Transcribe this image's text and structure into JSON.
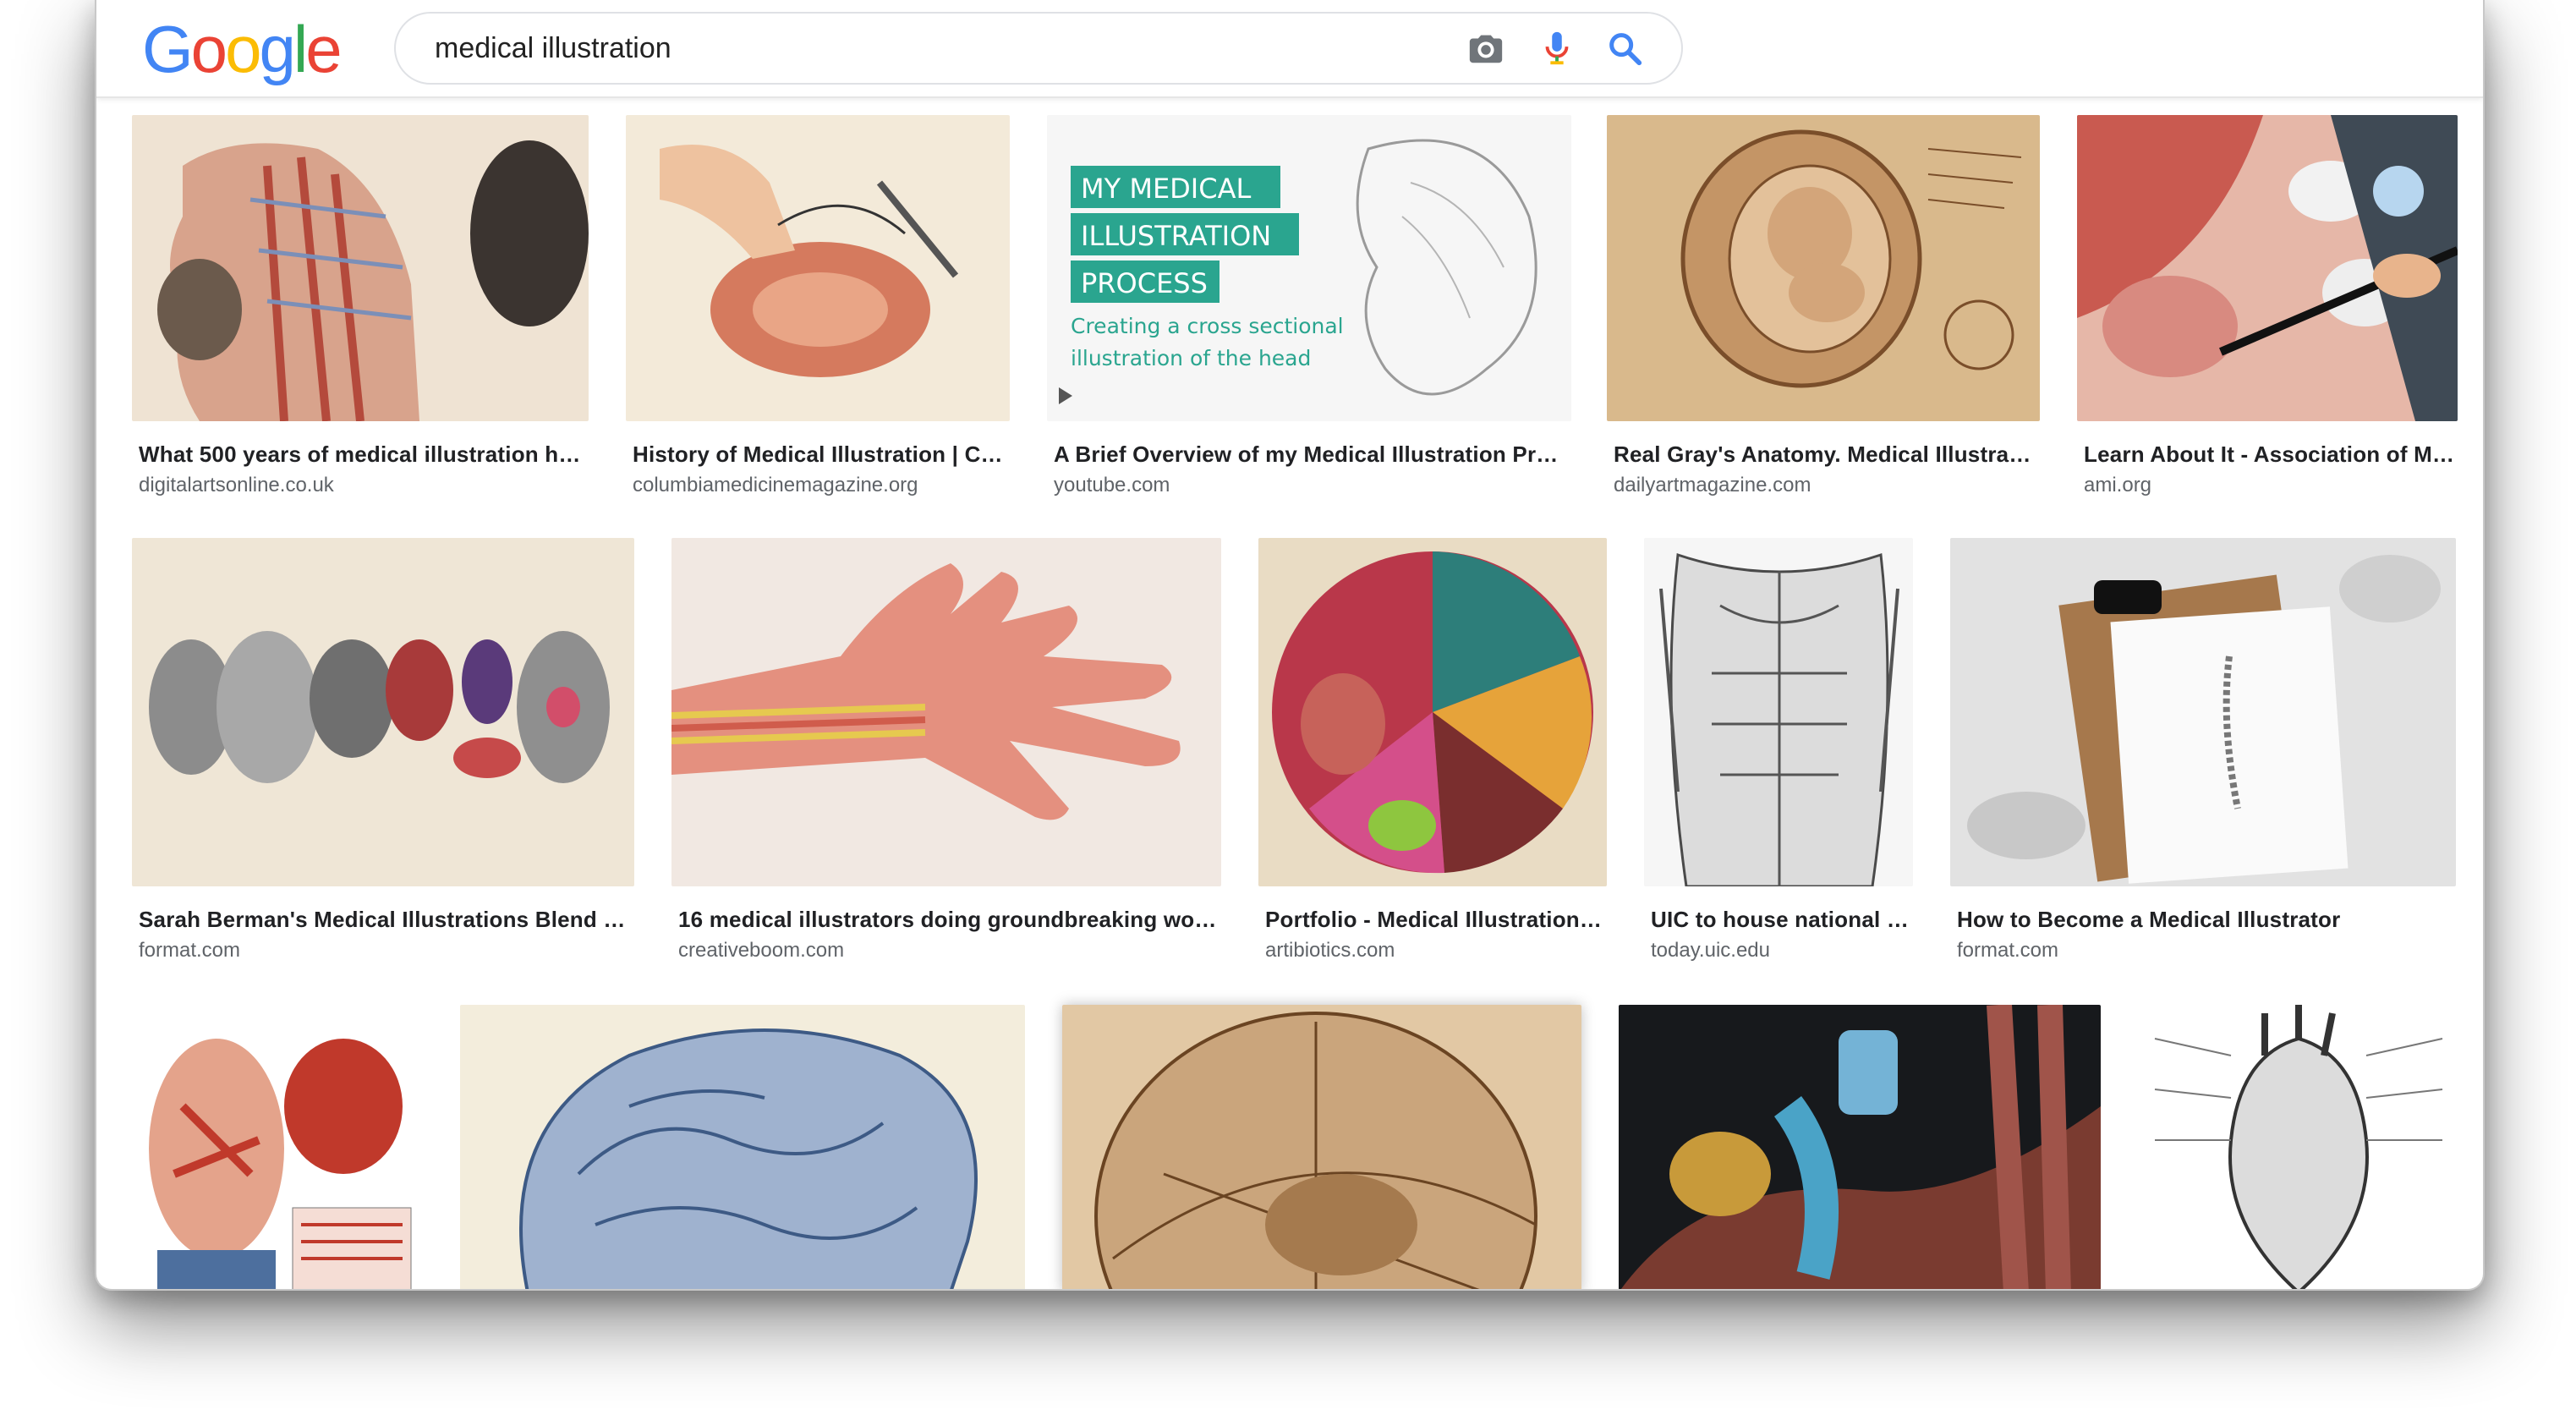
{
  "search": {
    "query": "medical illustration",
    "camera_icon": "camera-icon",
    "mic_icon": "mic-icon",
    "search_icon": "search-icon"
  },
  "logo": [
    "G",
    "o",
    "o",
    "g",
    "l",
    "e"
  ],
  "colors": {
    "google_blue": "#4285F4",
    "google_red": "#EA4335",
    "google_yellow": "#FBBC05",
    "google_green": "#34A853",
    "title": "#202124",
    "source": "#5f6368"
  },
  "results": [
    {
      "title": "What 500 years of medical illustration ha…",
      "source": "digitalartsonline.co.uk"
    },
    {
      "title": "History of Medical Illustration | C…",
      "source": "columbiamedicinemagazine.org"
    },
    {
      "title": "A Brief Overview of my Medical Illustration Pro…",
      "source": "youtube.com"
    },
    {
      "title": "Real Gray's Anatomy. Medical Illustrati…",
      "source": "dailyartmagazine.com"
    },
    {
      "title": "Learn About It - Association of M…",
      "source": "ami.org"
    },
    {
      "title": "Sarah Berman's Medical Illustrations Blend S…",
      "source": "format.com"
    },
    {
      "title": "16 medical illustrators doing groundbreaking wor…",
      "source": "creativeboom.com"
    },
    {
      "title": "Portfolio - Medical Illustration…",
      "source": "artibiotics.com"
    },
    {
      "title": "UIC to house national …",
      "source": "today.uic.edu"
    },
    {
      "title": "How to Become a Medical Illustrator",
      "source": "format.com"
    }
  ],
  "thumb_text": {
    "process_line1": "MY MEDICAL",
    "process_line2": "ILLUSTRATION",
    "process_line3": "PROCESS",
    "process_sub1": "Creating a cross sectional",
    "process_sub2": "illustration of the head"
  }
}
